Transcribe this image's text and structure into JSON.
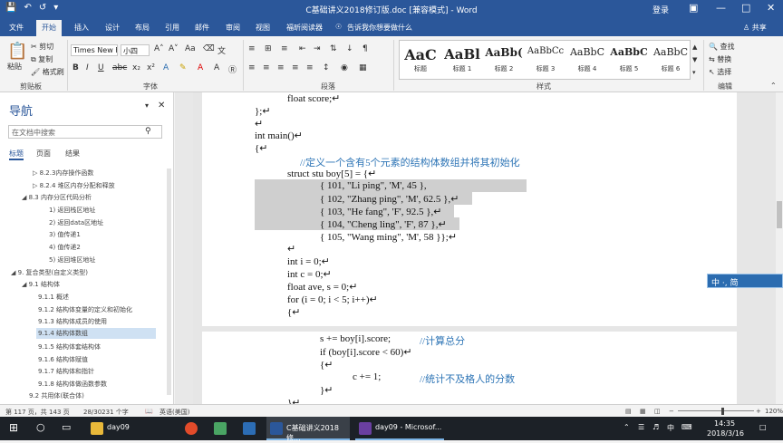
{
  "titlebar": {
    "title": "C基础讲义2018修订版.doc [兼容模式] - Word",
    "login": "登录",
    "save_icon": "save-icon",
    "undo_icon": "undo-icon",
    "redo_icon": "redo-icon"
  },
  "tabs": [
    "文件",
    "开始",
    "插入",
    "设计",
    "布局",
    "引用",
    "邮件",
    "审阅",
    "视图",
    "福昕阅读器"
  ],
  "tell_me": "告诉我你想要做什么",
  "share": "共享",
  "clipboard": {
    "paste": "粘贴",
    "cut": "剪切",
    "copy": "复制",
    "format_painter": "格式刷",
    "label": "剪贴板"
  },
  "font": {
    "name": "Times New F",
    "size": "小四",
    "label": "字体"
  },
  "paragraph": {
    "label": "段落"
  },
  "styles": {
    "label": "样式",
    "items": [
      {
        "preview": "AaC",
        "name": "标题"
      },
      {
        "preview": "AaBl",
        "name": "标题 1"
      },
      {
        "preview": "AaBb(",
        "name": "标题 2"
      },
      {
        "preview": "AaBbCc",
        "name": "标题 3"
      },
      {
        "preview": "AaBbC",
        "name": "标题 4"
      },
      {
        "preview": "AaBbC",
        "name": "标题 5"
      },
      {
        "preview": "AaBbC",
        "name": "标题 6"
      }
    ]
  },
  "editing": {
    "find": "查找",
    "replace": "替换",
    "select": "选择",
    "label": "编辑"
  },
  "nav": {
    "title": "导航",
    "search_placeholder": "在文档中搜索",
    "tabs": [
      "标题",
      "页面",
      "结果"
    ],
    "items": [
      "8.2.3内存操作函数",
      "8.2.4 堆区内存分配和释放",
      "8.3 内存分区代码分析",
      "1) 返回栈区地址",
      "2) 返回data区地址",
      "3) 值传递1",
      "4) 值传递2",
      "5) 返回堆区地址",
      "9. 复合类型(自定义类型)",
      "9.1 结构体",
      "9.1.1 概述",
      "9.1.2 结构体变量的定义和初始化",
      "9.1.3 结构体成员的使用",
      "9.1.4 结构体数组",
      "9.1.5 结构体套结构体",
      "9.1.6 结构体赋值",
      "9.1.7 结构体和指针",
      "9.1.8 结构体做函数参数",
      "9.2 共用体(联合体)"
    ]
  },
  "doc": {
    "lines": [
      "float score;↵",
      "};↵",
      "↵",
      "int main()↵",
      "{↵",
      "//定义一个含有5个元素的结构体数组并将其初始化",
      "struct stu boy[5] = {↵",
      "{ 101, \"Li ping\", 'M', 45 },",
      "{ 102, \"Zhang ping\", 'M', 62.5 },↵",
      "{ 103, \"He fang\", 'F', 92.5 },↵",
      "{ 104, \"Cheng ling\", 'F', 87 },↵",
      "{ 105, \"Wang ming\", 'M', 58 }};↵",
      "↵",
      "int i = 0;↵",
      "int c = 0;↵",
      "float ave, s = 0;↵",
      "for (i = 0; i < 5; i++)↵",
      "{↵",
      "s += boy[i].score;",
      "//计算总分",
      "if (boy[i].score < 60)↵",
      "{↵",
      "c += 1;",
      "//统计不及格人的分数",
      "}↵",
      "}↵"
    ]
  },
  "ime": "中 ·, 简",
  "status": {
    "page": "第 117 页，共 143 页",
    "words": "28/30231 个字",
    "lang": "英语(美国)",
    "zoom": "120%"
  },
  "taskbar": {
    "win1": "day09",
    "win2": "C基础讲义2018修...",
    "win3": "day09 - Microsof...",
    "ime": "中",
    "time": "14:35",
    "date": "2018/3/16"
  }
}
